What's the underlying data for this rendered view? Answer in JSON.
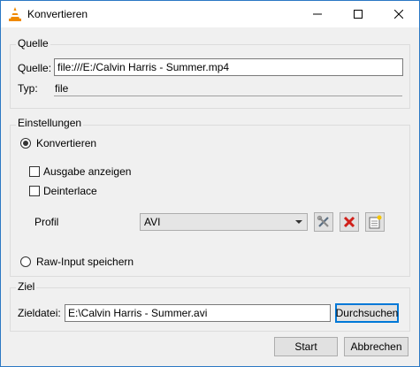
{
  "window": {
    "title": "Konvertieren"
  },
  "source": {
    "group_label": "Quelle",
    "field_label": "Quelle:",
    "value": "file:///E:/Calvin Harris - Summer.mp4",
    "type_label": "Typ:",
    "type_value": "file"
  },
  "settings": {
    "group_label": "Einstellungen",
    "convert_label": "Konvertieren",
    "convert_selected": true,
    "show_output_label": "Ausgabe anzeigen",
    "deinterlace_label": "Deinterlace",
    "profile_label": "Profil",
    "profile_value": "AVI",
    "raw_input_label": "Raw-Input speichern"
  },
  "destination": {
    "group_label": "Ziel",
    "file_label": "Zieldatei:",
    "file_value": "E:\\Calvin Harris - Summer.avi",
    "browse_label": "Durchsuchen"
  },
  "buttons": {
    "start": "Start",
    "cancel": "Abbrechen"
  }
}
